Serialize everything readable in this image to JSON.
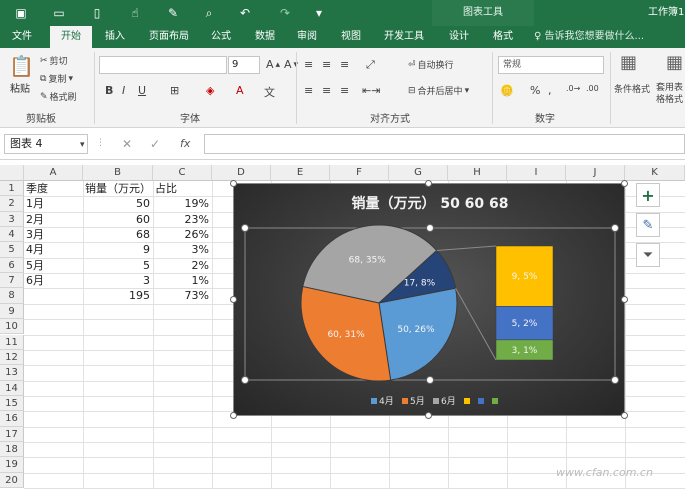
{
  "quick_access": {
    "save_icon": "save-icon",
    "open_icon": "open-icon",
    "new_icon": "new-icon",
    "touch_icon": "touch-mode-icon",
    "format_icon": "format-painter-icon",
    "preview_icon": "print-preview-icon",
    "undo_icon": "undo-icon",
    "redo_icon": "redo-icon",
    "customize_icon": "customize-icon"
  },
  "context_header": "图表工具",
  "window_title": "工作簿1",
  "tabs": [
    "文件",
    "开始",
    "插入",
    "页面布局",
    "公式",
    "数据",
    "审阅",
    "视图",
    "开发工具",
    "设计",
    "格式"
  ],
  "active_tab": "开始",
  "tell_me": "告诉我您想要做什么...",
  "ribbon": {
    "clipboard": {
      "paste": "粘贴",
      "cut": "剪切",
      "copy": "复制",
      "format_painter": "格式刷",
      "label": "剪贴板"
    },
    "font": {
      "font_name": "",
      "font_size": "9",
      "bold": "B",
      "italic": "I",
      "underline": "U",
      "font_color_label": "A",
      "label": "字体"
    },
    "alignment": {
      "wrap_text": "自动换行",
      "merge_center": "合并后居中",
      "label": "对齐方式"
    },
    "number": {
      "format": "常规",
      "percent": "%",
      "comma": ",",
      "label": "数字"
    },
    "styles": {
      "conditional": "条件格式",
      "table_format": "套用表格格式"
    }
  },
  "formula_bar": {
    "name_box": "图表 4",
    "fx": "fx",
    "value": ""
  },
  "columns": [
    "A",
    "B",
    "C",
    "D",
    "E",
    "F",
    "G",
    "H",
    "I",
    "J",
    "K"
  ],
  "rows": [
    "1",
    "2",
    "3",
    "4",
    "5",
    "6",
    "7",
    "8",
    "9",
    "10",
    "11",
    "12",
    "13",
    "14",
    "15",
    "16",
    "17",
    "18",
    "19",
    "20"
  ],
  "cells": [
    [
      "季度",
      "销量（万元）",
      "占比"
    ],
    [
      "1月",
      "50",
      "19%"
    ],
    [
      "2月",
      "60",
      "23%"
    ],
    [
      "3月",
      "68",
      "26%"
    ],
    [
      "4月",
      "9",
      "3%"
    ],
    [
      "5月",
      "5",
      "2%"
    ],
    [
      "6月",
      "3",
      "1%"
    ],
    [
      "",
      "195",
      "73%"
    ]
  ],
  "chart_data": {
    "type": "pie",
    "subtype": "bar-of-pie",
    "title": "销量（万元） 50 60 68",
    "slices": [
      {
        "label": "68, 35%",
        "value": 68,
        "percent": 35,
        "color": "#a5a5a5"
      },
      {
        "label": "17, 8%",
        "value": 17,
        "percent": 8,
        "color": "#264478"
      },
      {
        "label": "50, 26%",
        "value": 50,
        "percent": 26,
        "color": "#5b9bd5"
      },
      {
        "label": "60, 31%",
        "value": 60,
        "percent": 31,
        "color": "#ed7d31"
      }
    ],
    "bar_segments": [
      {
        "label": "9, 5%",
        "value": 9,
        "percent": 5,
        "color": "#ffc000"
      },
      {
        "label": "5, 2%",
        "value": 5,
        "percent": 2,
        "color": "#4472c4"
      },
      {
        "label": "3, 1%",
        "value": 3,
        "percent": 1,
        "color": "#70ad47"
      }
    ],
    "legend": [
      {
        "name": "4月",
        "color": "#5b9bd5"
      },
      {
        "name": "5月",
        "color": "#ed7d31"
      },
      {
        "name": "6月",
        "color": "#a5a5a5"
      },
      {
        "name": "",
        "color": "#ffc000"
      },
      {
        "name": "",
        "color": "#4472c4"
      },
      {
        "name": "",
        "color": "#70ad47"
      }
    ],
    "legend_position": "bottom"
  },
  "side_buttons": {
    "elements": "+",
    "styles_icon": "brush-icon",
    "filter_icon": "filter-icon"
  },
  "watermark": "www.cfan.com.cn"
}
